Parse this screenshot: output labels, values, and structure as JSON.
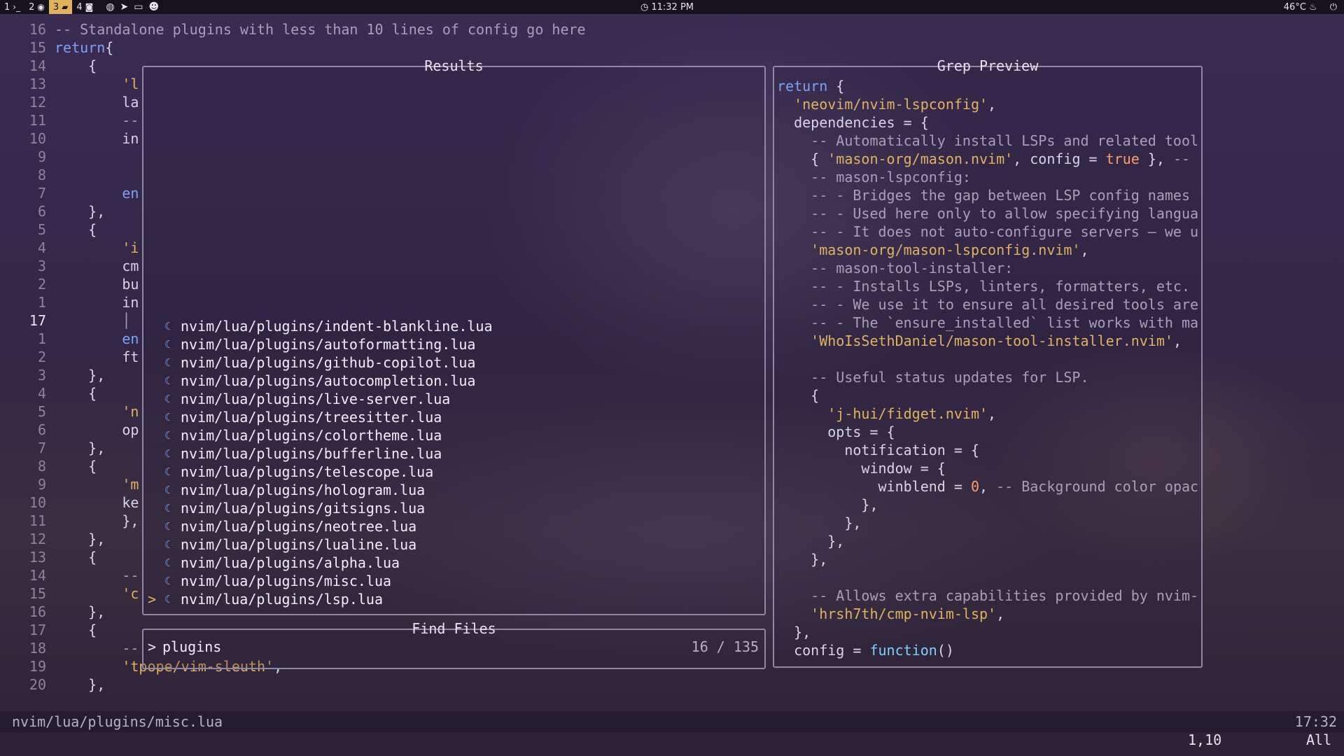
{
  "topbar": {
    "workspaces": [
      {
        "num": "1",
        "icon": "terminal-icon",
        "glyph": "›_"
      },
      {
        "num": "2",
        "icon": "browser-icon",
        "glyph": "◉"
      },
      {
        "num": "3",
        "icon": "folder-icon",
        "glyph": "▰"
      },
      {
        "num": "4",
        "icon": "camera-icon",
        "glyph": "◙"
      }
    ],
    "tray_icons": [
      "steam-icon",
      "telegram-icon",
      "window-icon",
      "discord-icon"
    ],
    "clock": "11:32 PM",
    "temperature": "46°C",
    "accent_color": "#e0b25e"
  },
  "editor": {
    "lines": [
      {
        "n": "16",
        "segs": [
          [
            "cmt",
            "-- Standalone plugins with less than 10 lines of config go here"
          ]
        ]
      },
      {
        "n": "15",
        "segs": [
          [
            "kw",
            "return"
          ],
          [
            "",
            "{"
          ]
        ]
      },
      {
        "n": "14",
        "segs": [
          [
            "",
            "    {"
          ]
        ]
      },
      {
        "n": "13",
        "segs": [
          [
            "str",
            "        'l"
          ]
        ]
      },
      {
        "n": "12",
        "segs": [
          [
            "",
            "        la"
          ]
        ]
      },
      {
        "n": "11",
        "segs": [
          [
            "cmt",
            "        --"
          ]
        ]
      },
      {
        "n": "10",
        "segs": [
          [
            "",
            "        in"
          ]
        ]
      },
      {
        "n": "9",
        "segs": [
          [
            "",
            ""
          ]
        ]
      },
      {
        "n": "8",
        "segs": [
          [
            "",
            ""
          ]
        ]
      },
      {
        "n": "7",
        "segs": [
          [
            "kw",
            "        en"
          ]
        ]
      },
      {
        "n": "6",
        "segs": [
          [
            "",
            "    },"
          ]
        ]
      },
      {
        "n": "5",
        "segs": [
          [
            "",
            "    {"
          ]
        ]
      },
      {
        "n": "4",
        "segs": [
          [
            "str",
            "        'i"
          ]
        ]
      },
      {
        "n": "3",
        "segs": [
          [
            "",
            "        cm"
          ]
        ]
      },
      {
        "n": "2",
        "segs": [
          [
            "",
            "        bu"
          ]
        ]
      },
      {
        "n": "1",
        "segs": [
          [
            "",
            "        in"
          ]
        ]
      },
      {
        "n": "17",
        "cur": true,
        "segs": [
          [
            "cmt",
            "        │"
          ]
        ]
      },
      {
        "n": "1",
        "segs": [
          [
            "kw",
            "        en"
          ]
        ]
      },
      {
        "n": "2",
        "segs": [
          [
            "",
            "        ft"
          ]
        ]
      },
      {
        "n": "3",
        "segs": [
          [
            "",
            "    },"
          ]
        ]
      },
      {
        "n": "4",
        "segs": [
          [
            "",
            "    {"
          ]
        ]
      },
      {
        "n": "5",
        "segs": [
          [
            "str",
            "        'n"
          ]
        ]
      },
      {
        "n": "6",
        "segs": [
          [
            "",
            "        op"
          ]
        ]
      },
      {
        "n": "7",
        "segs": [
          [
            "",
            "    },"
          ]
        ]
      },
      {
        "n": "8",
        "segs": [
          [
            "",
            "    {"
          ]
        ]
      },
      {
        "n": "9",
        "segs": [
          [
            "str",
            "        'm"
          ]
        ]
      },
      {
        "n": "10",
        "segs": [
          [
            "",
            "        ke"
          ]
        ]
      },
      {
        "n": "11",
        "segs": [
          [
            "",
            "        },"
          ]
        ]
      },
      {
        "n": "12",
        "segs": [
          [
            "",
            "    },"
          ]
        ]
      },
      {
        "n": "13",
        "segs": [
          [
            "",
            "    {"
          ]
        ]
      },
      {
        "n": "14",
        "segs": [
          [
            "cmt",
            "        --"
          ]
        ]
      },
      {
        "n": "15",
        "segs": [
          [
            "str",
            "        'c"
          ]
        ]
      },
      {
        "n": "16",
        "segs": [
          [
            "",
            "    },"
          ]
        ]
      },
      {
        "n": "17",
        "segs": [
          [
            "",
            "    {"
          ]
        ]
      },
      {
        "n": "18",
        "segs": [
          [
            "cmt",
            "        --"
          ]
        ]
      },
      {
        "n": "19",
        "segs": [
          [
            "str",
            "        'tpope/vim-sleuth'"
          ],
          [
            "",
            ","
          ]
        ]
      },
      {
        "n": "20",
        "segs": [
          [
            "",
            "    },"
          ]
        ]
      }
    ]
  },
  "results": {
    "title": "Results",
    "items": [
      "nvim/lua/plugins/indent-blankline.lua",
      "nvim/lua/plugins/autoformatting.lua",
      "nvim/lua/plugins/github-copilot.lua",
      "nvim/lua/plugins/autocompletion.lua",
      "nvim/lua/plugins/live-server.lua",
      "nvim/lua/plugins/treesitter.lua",
      "nvim/lua/plugins/colortheme.lua",
      "nvim/lua/plugins/bufferline.lua",
      "nvim/lua/plugins/telescope.lua",
      "nvim/lua/plugins/hologram.lua",
      "nvim/lua/plugins/gitsigns.lua",
      "nvim/lua/plugins/neotree.lua",
      "nvim/lua/plugins/lualine.lua",
      "nvim/lua/plugins/alpha.lua",
      "nvim/lua/plugins/misc.lua",
      "nvim/lua/plugins/lsp.lua"
    ],
    "selected_index": 15,
    "selector": ">"
  },
  "find": {
    "title": "Find Files",
    "caret": ">",
    "query": "plugins",
    "count": "16 / 135"
  },
  "preview": {
    "title": "Grep Preview",
    "lines": [
      [
        [
          "kw",
          "return"
        ],
        [
          "",
          " {"
        ]
      ],
      [
        [
          "",
          "  "
        ],
        [
          "str",
          "'neovim/nvim-lspconfig'"
        ],
        [
          "",
          ","
        ]
      ],
      [
        [
          "",
          "  dependencies = {"
        ]
      ],
      [
        [
          "cmt",
          "    -- Automatically install LSPs and related tool"
        ]
      ],
      [
        [
          "",
          "    { "
        ],
        [
          "str",
          "'mason-org/mason.nvim'"
        ],
        [
          "",
          ", config = "
        ],
        [
          "bool",
          "true"
        ],
        [
          "",
          " }, "
        ],
        [
          "cmt",
          "--"
        ]
      ],
      [
        [
          "cmt",
          "    -- mason-lspconfig:"
        ]
      ],
      [
        [
          "cmt",
          "    -- - Bridges the gap between LSP config names"
        ]
      ],
      [
        [
          "cmt",
          "    -- - Used here only to allow specifying langua"
        ]
      ],
      [
        [
          "cmt",
          "    -- - It does not auto-configure servers – we u"
        ]
      ],
      [
        [
          "",
          "    "
        ],
        [
          "str",
          "'mason-org/mason-lspconfig.nvim'"
        ],
        [
          "",
          ","
        ]
      ],
      [
        [
          "cmt",
          "    -- mason-tool-installer:"
        ]
      ],
      [
        [
          "cmt",
          "    -- - Installs LSPs, linters, formatters, etc."
        ]
      ],
      [
        [
          "cmt",
          "    -- - We use it to ensure all desired tools are"
        ]
      ],
      [
        [
          "cmt",
          "    -- - The `ensure_installed` list works with ma"
        ]
      ],
      [
        [
          "",
          "    "
        ],
        [
          "str",
          "'WhoIsSethDaniel/mason-tool-installer.nvim'"
        ],
        [
          "",
          ","
        ]
      ],
      [
        [
          "",
          ""
        ]
      ],
      [
        [
          "cmt",
          "    -- Useful status updates for LSP."
        ]
      ],
      [
        [
          "",
          "    {"
        ]
      ],
      [
        [
          "",
          "      "
        ],
        [
          "str",
          "'j-hui/fidget.nvim'"
        ],
        [
          "",
          ","
        ]
      ],
      [
        [
          "",
          "      opts = {"
        ]
      ],
      [
        [
          "",
          "        notification = {"
        ]
      ],
      [
        [
          "",
          "          window = {"
        ]
      ],
      [
        [
          "",
          "            winblend = "
        ],
        [
          "num",
          "0"
        ],
        [
          "",
          ", "
        ],
        [
          "cmt",
          "-- Background color opac"
        ]
      ],
      [
        [
          "",
          "          },"
        ]
      ],
      [
        [
          "",
          "        },"
        ]
      ],
      [
        [
          "",
          "      },"
        ]
      ],
      [
        [
          "",
          "    },"
        ]
      ],
      [
        [
          "",
          ""
        ]
      ],
      [
        [
          "cmt",
          "    -- Allows extra capabilities provided by nvim-"
        ]
      ],
      [
        [
          "",
          "    "
        ],
        [
          "str",
          "'hrsh7th/cmp-nvim-lsp'"
        ],
        [
          "",
          ","
        ]
      ],
      [
        [
          "",
          "  },"
        ]
      ],
      [
        [
          "",
          "  config = "
        ],
        [
          "fn",
          "function"
        ],
        [
          "",
          "()"
        ]
      ]
    ]
  },
  "statusline": {
    "file": "nvim/lua/plugins/misc.lua",
    "time": "17:32"
  },
  "cmdline": {
    "position": "1,10",
    "scroll": "All"
  }
}
